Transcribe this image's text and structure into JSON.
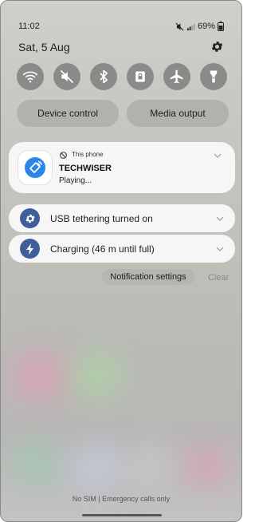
{
  "status_bar": {
    "time": "11:02",
    "battery": "69%",
    "icons": [
      "mute-icon",
      "signal-icon",
      "battery-icon"
    ]
  },
  "panel": {
    "date": "Sat, 5 Aug",
    "settings_icon": "gear-icon"
  },
  "quick_settings": {
    "tiles": [
      {
        "name": "wifi-icon",
        "active": false
      },
      {
        "name": "sound-off-icon",
        "active": false
      },
      {
        "name": "bluetooth-icon",
        "active": false
      },
      {
        "name": "screen-rotation-lock-icon",
        "active": false
      },
      {
        "name": "airplane-icon",
        "active": false
      },
      {
        "name": "flashlight-icon",
        "active": false
      }
    ],
    "device_control_label": "Device control",
    "media_output_label": "Media output"
  },
  "notifications": [
    {
      "source": "This phone",
      "title": "TECHWISER",
      "subtitle": "Playing...",
      "icon": "speaker-icon",
      "icon_color": "#2a86e8"
    },
    {
      "title": "USB tethering turned on",
      "icon": "settings-icon",
      "icon_color": "#3f5f9a"
    },
    {
      "title": "Charging (46 m until full)",
      "icon": "bolt-icon",
      "icon_color": "#3f5f9a"
    }
  ],
  "actions": {
    "notification_settings_label": "Notification settings",
    "clear_label": "Clear"
  },
  "footer": {
    "text": "No SIM | Emergency calls only"
  }
}
